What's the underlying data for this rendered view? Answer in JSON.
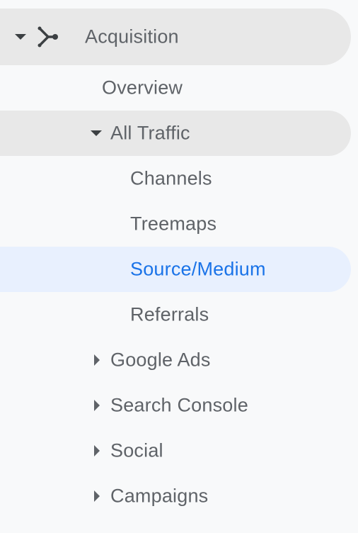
{
  "nav": {
    "section": {
      "label": "Acquisition",
      "icon": "acquisition-icon",
      "expanded": true
    },
    "overview": {
      "label": "Overview"
    },
    "all_traffic": {
      "label": "All Traffic",
      "expanded": true,
      "items": [
        {
          "label": "Channels",
          "selected": false
        },
        {
          "label": "Treemaps",
          "selected": false
        },
        {
          "label": "Source/Medium",
          "selected": true
        },
        {
          "label": "Referrals",
          "selected": false
        }
      ]
    },
    "collapsed_groups": [
      {
        "label": "Google Ads"
      },
      {
        "label": "Search Console"
      },
      {
        "label": "Social"
      },
      {
        "label": "Campaigns"
      }
    ]
  },
  "colors": {
    "background": "#f8f9fa",
    "hover_row": "#e8e8e8",
    "selected_bg": "#e8f0fe",
    "selected_text": "#1a73e8",
    "text": "#5f6368"
  }
}
